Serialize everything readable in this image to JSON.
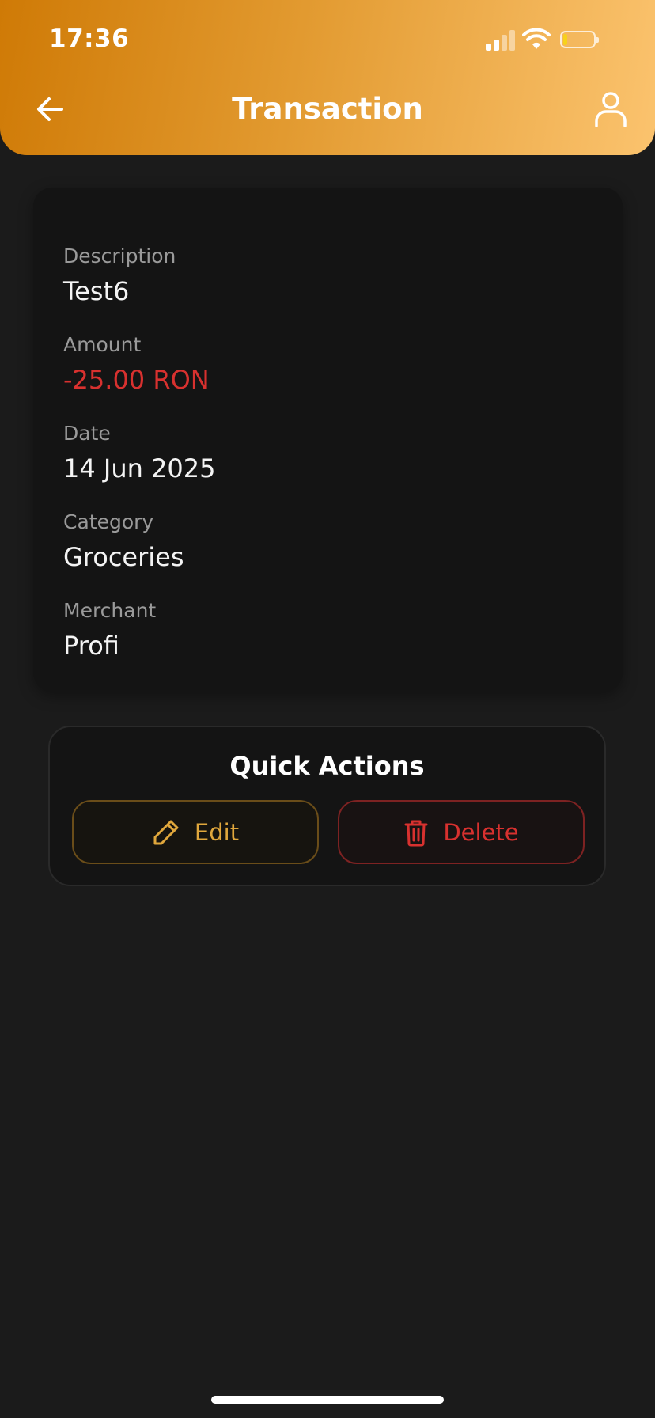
{
  "status_bar": {
    "time": "17:36"
  },
  "header": {
    "title": "Transaction",
    "back_icon": "arrow-left-icon",
    "profile_icon": "user-icon"
  },
  "details": {
    "fields": [
      {
        "label": "Description",
        "value": "Test6"
      },
      {
        "label": "Amount",
        "value": "-25.00 RON"
      },
      {
        "label": "Date",
        "value": "14 Jun 2025"
      },
      {
        "label": "Category",
        "value": "Groceries"
      },
      {
        "label": "Merchant",
        "value": "Profi"
      }
    ]
  },
  "quick_actions": {
    "title": "Quick Actions",
    "edit_label": "Edit",
    "delete_label": "Delete",
    "edit_icon": "pencil-icon",
    "delete_icon": "trash-icon"
  },
  "colors": {
    "header_start": "#cf7a06",
    "header_end": "#fbc36e",
    "negative_amount": "#d8312f",
    "edit_accent": "#e0a73c",
    "delete_accent": "#d8312f",
    "background": "#1b1b1b"
  }
}
